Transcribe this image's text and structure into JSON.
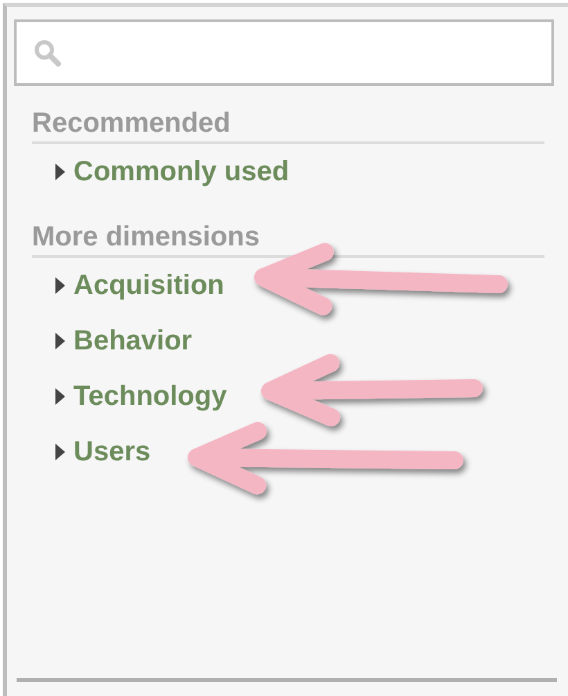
{
  "sections": [
    {
      "title": "Recommended",
      "items": [
        {
          "label": "Commonly used",
          "expanded": false
        }
      ]
    },
    {
      "title": "More dimensions",
      "items": [
        {
          "label": "Acquisition",
          "expanded": false
        },
        {
          "label": "Behavior",
          "expanded": false
        },
        {
          "label": "Technology",
          "expanded": false
        },
        {
          "label": "Users",
          "expanded": false
        }
      ]
    }
  ]
}
